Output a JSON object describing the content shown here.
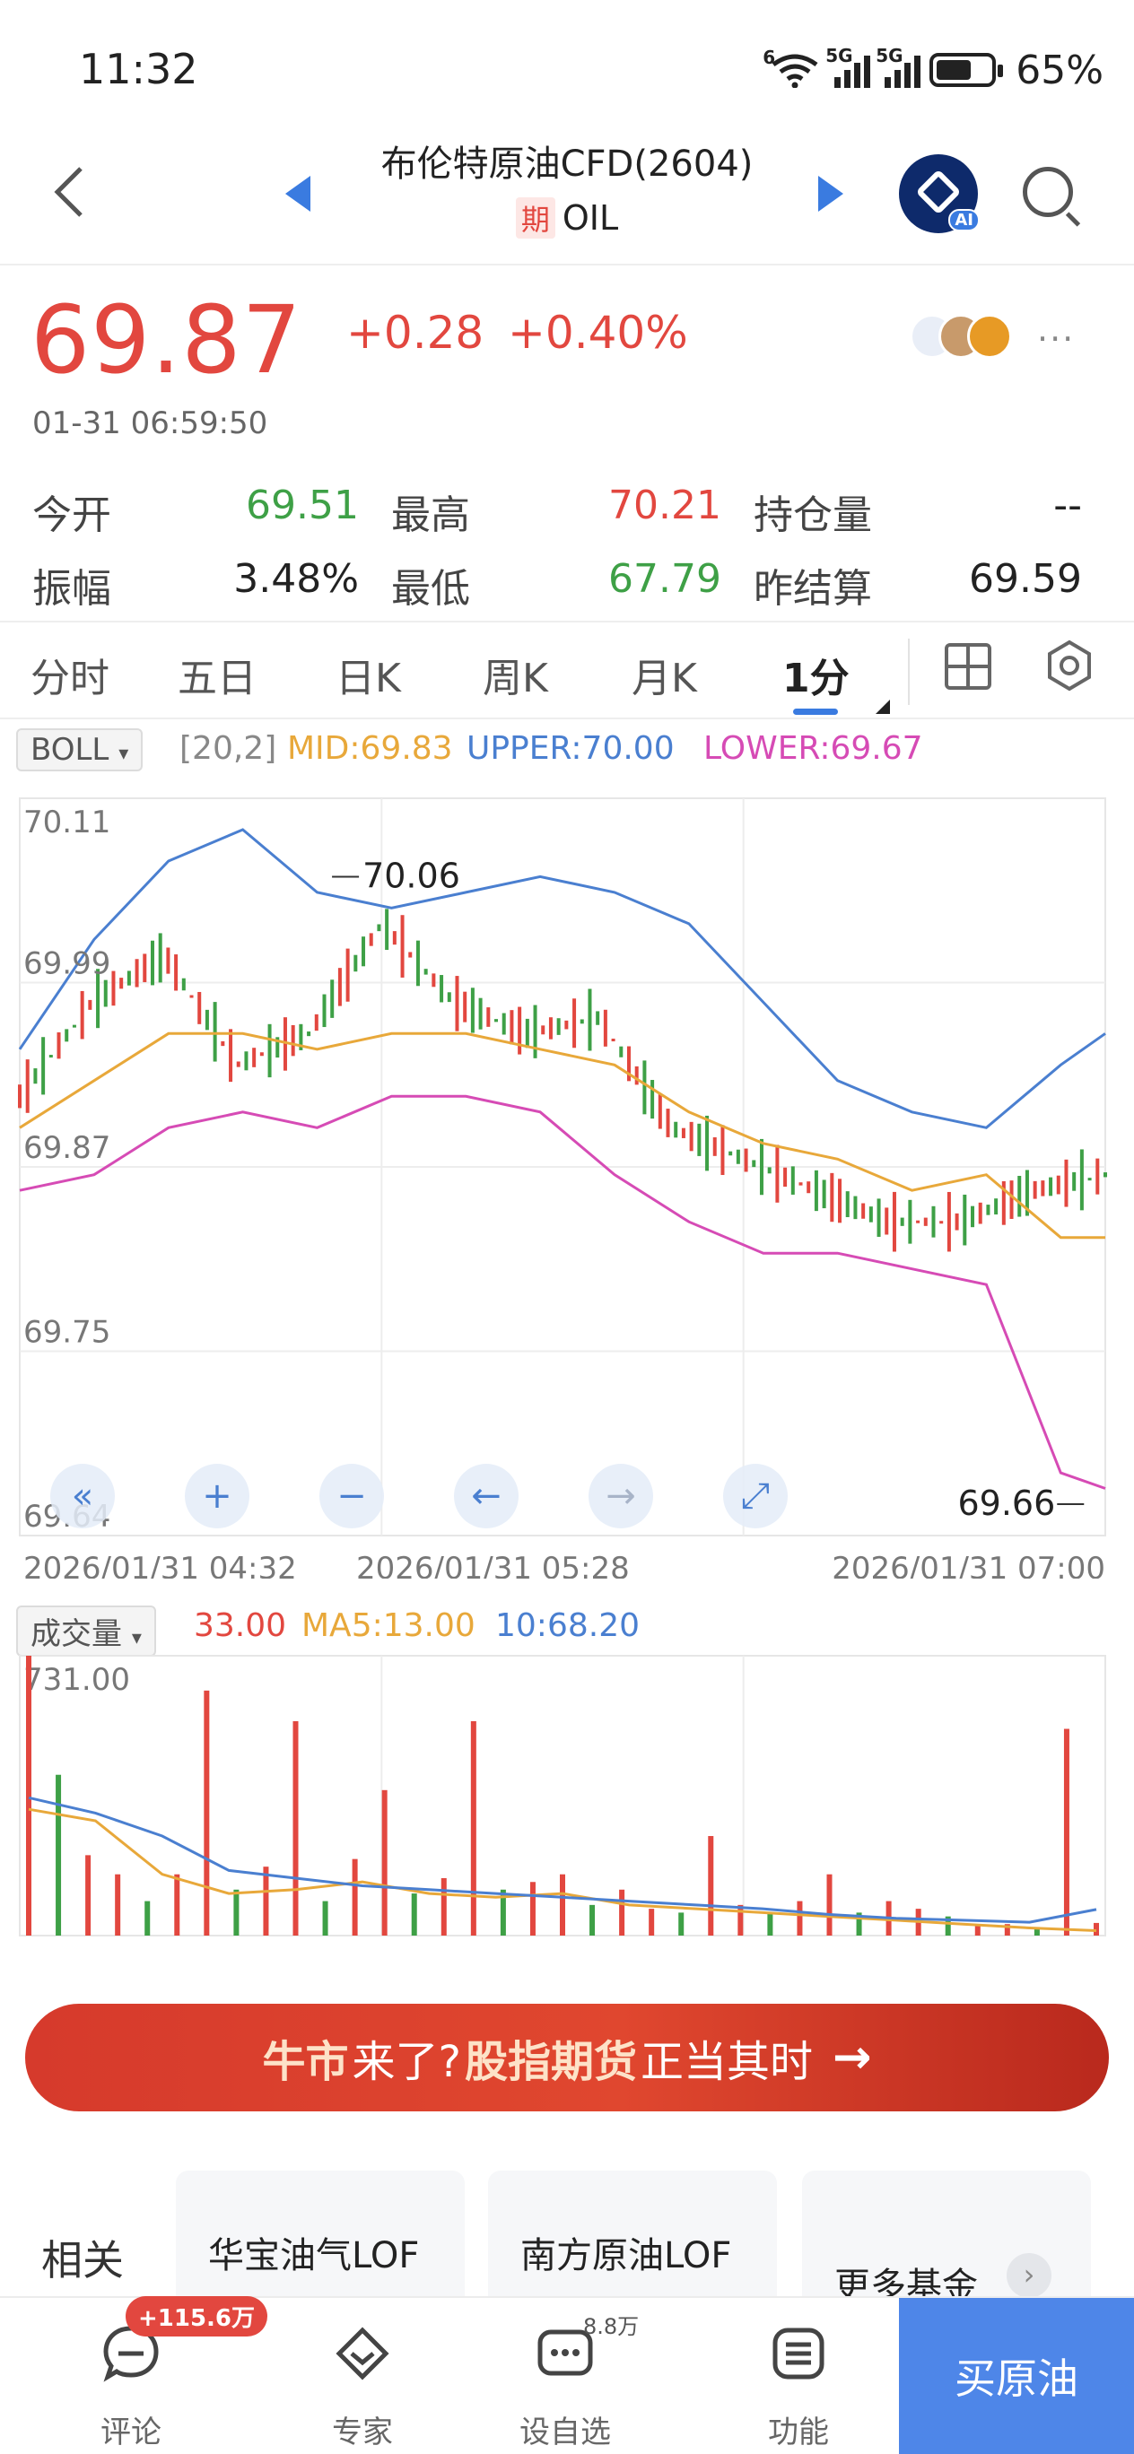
{
  "status_bar": {
    "time": "11:32",
    "battery": "65%",
    "network_1": "5G",
    "network_2": "5G",
    "wifi_tag": "6"
  },
  "header": {
    "title": "布伦特原油CFD(2604)",
    "tag": "期",
    "symbol": "OIL",
    "ai_badge": "AI"
  },
  "quote": {
    "price": "69.87",
    "change": "+0.28",
    "change_pct": "+0.40%",
    "timestamp": "01-31 06:59:50",
    "more": "···"
  },
  "stats": [
    {
      "label": "今开",
      "value": "69.51",
      "color": "green"
    },
    {
      "label": "最高",
      "value": "70.21",
      "color": "red"
    },
    {
      "label": "持仓量",
      "value": "--",
      "color": "dark"
    },
    {
      "label": "振幅",
      "value": "3.48%",
      "color": "dark"
    },
    {
      "label": "最低",
      "value": "67.79",
      "color": "green"
    },
    {
      "label": "昨结算",
      "value": "69.59",
      "color": "dark"
    }
  ],
  "tabs": [
    "分时",
    "五日",
    "日K",
    "周K",
    "月K",
    "1分"
  ],
  "active_tab": "1分",
  "boll": {
    "selector": "BOLL",
    "params": "[20,2]",
    "mid": "MID:69.83",
    "upper": "UPPER:70.00",
    "lower": "LOWER:69.67"
  },
  "volume": {
    "selector": "成交量",
    "vol": "33.00",
    "ma5": "MA5:13.00",
    "ma10": "10:68.20",
    "max_label": "731.00"
  },
  "banner": {
    "part1": "牛市",
    "part2": "来了? ",
    "part3": "股指期货",
    "part4": "正当其时"
  },
  "related": {
    "label": "相关基金",
    "funds": [
      "华宝油气LOF",
      "南方原油LOF",
      "更多基金"
    ]
  },
  "bottom_nav": {
    "comment_badge": "+115.6万",
    "watch_badge": "8.8万",
    "items": [
      "评论",
      "专家",
      "设自选",
      "功能"
    ],
    "buy": "买原油"
  },
  "colors": {
    "up": "#e2473f",
    "down": "#3ea046",
    "mid_line": "#e8a83a",
    "upper_line": "#4a7fd0",
    "lower_line": "#d64bb5",
    "accent": "#3a7be0"
  },
  "chart_data": [
    {
      "type": "line",
      "indicator": "BOLL",
      "yticks": [
        "70.11",
        "69.99",
        "69.87",
        "69.75",
        "69.64"
      ],
      "ylim": [
        69.64,
        70.11
      ],
      "xticks": [
        "2026/01/31 04:32",
        "2026/01/31 05:28",
        "2026/01/31 07:00"
      ],
      "annotations": [
        {
          "text": "70.06",
          "y": 70.06
        },
        {
          "text": "69.66",
          "y": 69.66
        }
      ],
      "x": [
        0,
        10,
        20,
        30,
        40,
        50,
        60,
        70,
        80,
        90,
        100,
        110,
        120,
        130,
        140,
        146
      ],
      "series": [
        {
          "name": "UPPER",
          "values": [
            69.95,
            70.02,
            70.07,
            70.09,
            70.05,
            70.04,
            70.05,
            70.06,
            70.05,
            70.03,
            69.98,
            69.93,
            69.91,
            69.9,
            69.94,
            69.96
          ]
        },
        {
          "name": "MID",
          "values": [
            69.9,
            69.93,
            69.96,
            69.96,
            69.95,
            69.96,
            69.96,
            69.95,
            69.94,
            69.91,
            69.89,
            69.88,
            69.86,
            69.87,
            69.83,
            69.83
          ]
        },
        {
          "name": "LOWER",
          "values": [
            69.86,
            69.87,
            69.9,
            69.91,
            69.9,
            69.92,
            69.92,
            69.91,
            69.87,
            69.84,
            69.82,
            69.82,
            69.81,
            69.8,
            69.68,
            69.67
          ]
        },
        {
          "name": "PRICE",
          "values": [
            69.92,
            69.98,
            70.01,
            69.94,
            69.96,
            70.03,
            69.98,
            69.96,
            69.97,
            69.9,
            69.88,
            69.86,
            69.84,
            69.84,
            69.86,
            69.87
          ]
        }
      ]
    },
    {
      "type": "bar",
      "indicator": "VOL",
      "ylim": [
        0,
        731
      ],
      "yticks": [
        "731.00"
      ],
      "x": [
        0,
        4,
        8,
        12,
        16,
        20,
        24,
        28,
        32,
        36,
        40,
        44,
        48,
        52,
        56,
        60,
        64,
        68,
        72,
        76,
        80,
        84,
        88,
        92,
        96,
        100,
        104,
        108,
        112,
        116,
        120,
        124,
        128,
        132,
        136,
        140,
        144
      ],
      "values": [
        731,
        420,
        210,
        160,
        90,
        160,
        640,
        120,
        180,
        560,
        90,
        200,
        380,
        110,
        150,
        560,
        120,
        140,
        160,
        80,
        120,
        70,
        60,
        260,
        80,
        60,
        90,
        160,
        60,
        90,
        70,
        50,
        30,
        30,
        20,
        540,
        33
      ],
      "series": [
        {
          "name": "MA5",
          "values": [
            330,
            300,
            160,
            110,
            120,
            140,
            110,
            100,
            110,
            80,
            70,
            60,
            50,
            40,
            30,
            20,
            13
          ]
        },
        {
          "name": "10",
          "values": [
            360,
            320,
            260,
            170,
            150,
            130,
            120,
            110,
            100,
            90,
            80,
            70,
            55,
            45,
            40,
            35,
            68.2
          ]
        }
      ]
    }
  ]
}
